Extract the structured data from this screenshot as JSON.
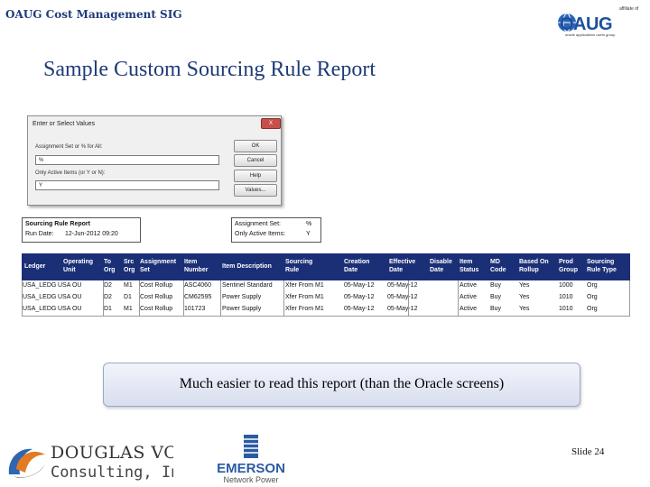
{
  "header": {
    "title": "OAUG Cost Management SIG",
    "oaug_affiliate": "affiliate of",
    "oaug_logo": "OAUG",
    "oaug_tagline": "oracle applications users group"
  },
  "slide_title": "Sample Custom Sourcing Rule Report",
  "dialog": {
    "title": "Enter or Select Values",
    "close": "X",
    "field1_label": "Assignment Set or % for All:",
    "field1_value": "%",
    "field2_label": "Only Active Items (or Y or N):",
    "field2_value": "Y",
    "buttons": [
      "OK",
      "Cancel",
      "Help",
      "Values..."
    ]
  },
  "report_info": {
    "name_label": "Sourcing Rule Report",
    "run_date_label": "Run Date:",
    "run_date_value": "12-Jun-2012 09:20",
    "assignment_label": "Assignment Set:",
    "assignment_value": "%",
    "active_label": "Only Active Items:",
    "active_value": "Y"
  },
  "table": {
    "columns": [
      "Ledger",
      "Operating Unit",
      "To Org",
      "Src Org",
      "Assignment Set",
      "Item Number",
      "Item Description",
      "Sourcing Rule",
      "Creation Date",
      "Effective Date",
      "Disable Date",
      "Item Status",
      "MD Code",
      "Based On Rollup",
      "Prod Group",
      "Sourcing Rule Type"
    ],
    "rows": [
      [
        "USA_LEDG",
        "USA OU",
        "D2",
        "M1",
        "Cost Rollup",
        "ASC4060",
        "Sentinel Standard",
        "Xfer From M1",
        "05-May-12",
        "05-May-12",
        "",
        "Active",
        "Buy",
        "Yes",
        "1000",
        "Org"
      ],
      [
        "USA_LEDG",
        "USA OU",
        "D2",
        "D1",
        "Cost Rollup",
        "CM62595",
        "Power Supply",
        "Xfer From M1",
        "05-May-12",
        "05-May-12",
        "",
        "Active",
        "Buy",
        "Yes",
        "1010",
        "Org"
      ],
      [
        "USA_LEDG",
        "USA OU",
        "D1",
        "M1",
        "Cost Rollup",
        "101723",
        "Power Supply",
        "Xfer From M1",
        "05-May-12",
        "05-May-12",
        "",
        "Active",
        "Buy",
        "Yes",
        "1010",
        "Org"
      ]
    ]
  },
  "callout": "Much easier to read this report (than the Oracle screens)",
  "slide_number": "Slide 24",
  "footer": {
    "dv_name": "DOUGLAS VOLZ",
    "dv_sub": "Consulting, Inc.",
    "emerson_name": "EMERSON",
    "emerson_sub": "Network Power"
  },
  "colors": {
    "title_blue": "#1f3c78",
    "table_header": "#1b2f77"
  }
}
